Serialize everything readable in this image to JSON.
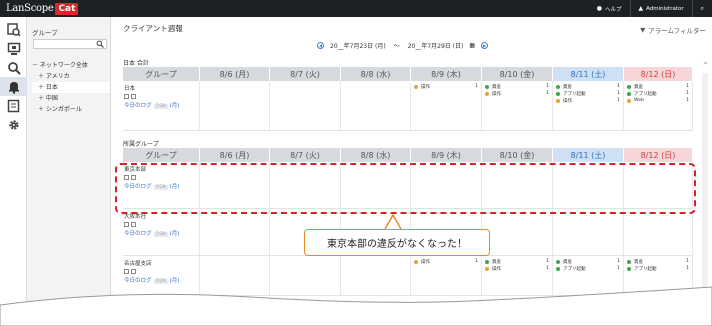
{
  "app": {
    "logo_text": "LanScope",
    "logo_badge": "Cat",
    "help_label": "ヘルプ",
    "user_label": "Administrator"
  },
  "tree": {
    "title": "グループ",
    "search_placeholder": "",
    "items": [
      {
        "label": "－ ネットワーク全体"
      },
      {
        "label": "＋ アメリカ"
      },
      {
        "label": "＋ 日本"
      },
      {
        "label": "＋ 中国"
      },
      {
        "label": "＋ シンガポール"
      }
    ]
  },
  "page": {
    "title": "クライアント週報",
    "alarm_filter": "アラームフィルター",
    "date_range_start": "20__年7月23日 (月)",
    "date_range_sep": "～",
    "date_range_end": "20__年7月29日 (日)"
  },
  "headers": {
    "group": "グループ",
    "days": [
      {
        "label": "8/6 (月)",
        "kind": "weekday"
      },
      {
        "label": "8/7 (火)",
        "kind": "weekday"
      },
      {
        "label": "8/8 (水)",
        "kind": "weekday"
      },
      {
        "label": "8/9 (木)",
        "kind": "weekday"
      },
      {
        "label": "8/10 (金)",
        "kind": "weekday"
      },
      {
        "label": "8/11 (土)",
        "kind": "sat"
      },
      {
        "label": "8/12 (日)",
        "kind": "sun"
      }
    ]
  },
  "sections": {
    "total_label": "日本 合計",
    "assigned_label": "所属グループ"
  },
  "total_row": {
    "name": "日本",
    "log_label": "今日のログ",
    "log_date": "7/29",
    "log_day": "(月)"
  },
  "events": {
    "d4": [
      {
        "label": "操作",
        "count": "1",
        "color": "#e8a03a"
      }
    ],
    "d5": [
      {
        "label": "資産",
        "count": "1",
        "color": "#3aa84a"
      },
      {
        "label": "操作",
        "count": "1",
        "color": "#e8a03a"
      }
    ],
    "d6": [
      {
        "label": "資産",
        "count": "1",
        "color": "#3aa84a"
      },
      {
        "label": "アプリ起動",
        "count": "1",
        "color": "#3aa84a"
      },
      {
        "label": "操作",
        "count": "1",
        "color": "#e8a03a"
      }
    ],
    "d7": [
      {
        "label": "資産",
        "count": "1",
        "color": "#3aa84a"
      },
      {
        "label": "アプリ起動",
        "count": "1",
        "color": "#3aa84a"
      },
      {
        "label": "Web",
        "count": "1",
        "color": "#e8a03a"
      }
    ],
    "nagoya_d4": [
      {
        "label": "操作",
        "count": "1",
        "color": "#e8a03a"
      }
    ],
    "nagoya_d5": [
      {
        "label": "資産",
        "count": "1",
        "color": "#3aa84a"
      },
      {
        "label": "操作",
        "count": "1",
        "color": "#e8a03a"
      }
    ],
    "nagoya_d6": [
      {
        "label": "資産",
        "count": "1",
        "color": "#3aa84a"
      },
      {
        "label": "アプリ起動",
        "count": "1",
        "color": "#3aa84a"
      }
    ],
    "nagoya_d7": [
      {
        "label": "資産",
        "count": "1",
        "color": "#3aa84a"
      },
      {
        "label": "アプリ起動",
        "count": "1",
        "color": "#3aa84a"
      }
    ]
  },
  "groups": [
    {
      "name": "東京本部",
      "log_label": "今日のログ",
      "log_date": "7/29",
      "log_day": "(月)"
    },
    {
      "name": "大阪本社",
      "log_label": "今日のログ",
      "log_date": "7/29",
      "log_day": "(月)"
    },
    {
      "name": "名古屋支店",
      "log_label": "今日のログ",
      "log_date": "7/29",
      "log_day": "(月)"
    }
  ],
  "callout": {
    "text": "東京本部の違反がなくなった！"
  },
  "colors": {
    "accent": "#2b6fc0",
    "highlight": "#d4242a",
    "callout_border": "#e88a2c"
  }
}
